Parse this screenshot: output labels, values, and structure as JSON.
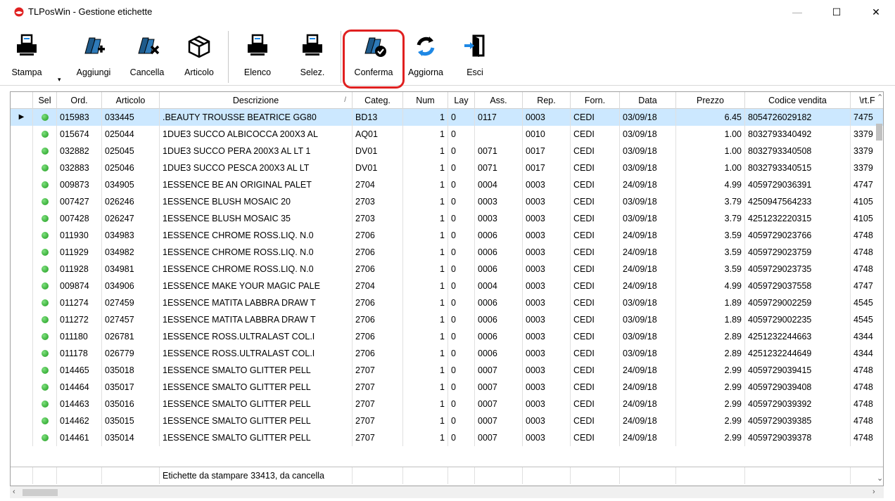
{
  "window": {
    "title": "TLPosWin - Gestione etichette",
    "minimize": "—",
    "maximize": "☐",
    "close": "✕"
  },
  "toolbar": {
    "stampa": "Stampa",
    "aggiungi": "Aggiungi",
    "cancella": "Cancella",
    "articolo": "Articolo",
    "elenco": "Elenco",
    "selez": "Selez.",
    "conferma": "Conferma",
    "aggiorna": "Aggiorna",
    "esci": "Esci"
  },
  "columns": [
    "Sel",
    "Ord.",
    "Articolo",
    "Descrizione",
    "Categ.",
    "Num",
    "Lay",
    "Ass.",
    "Rep.",
    "Forn.",
    "Data",
    "Prezzo",
    "Codice vendita",
    "\\rt.F"
  ],
  "sort_indicator": "/",
  "rows": [
    [
      "015983",
      "033445",
      ".BEAUTY TROUSSE BEATRICE GG80",
      "BD13",
      "1",
      "0",
      "0117",
      "0003",
      "CEDI",
      "03/09/18",
      "6.45",
      "8054726029182",
      "7475"
    ],
    [
      "015674",
      "025044",
      "1DUE3 SUCCO ALBICOCCA 200X3 AL",
      "AQ01",
      "1",
      "0",
      "",
      "0010",
      "CEDI",
      "03/09/18",
      "1.00",
      "8032793340492",
      "3379"
    ],
    [
      "032882",
      "025045",
      "1DUE3 SUCCO PERA 200X3 AL LT 1",
      "DV01",
      "1",
      "0",
      "0071",
      "0017",
      "CEDI",
      "03/09/18",
      "1.00",
      "8032793340508",
      "3379"
    ],
    [
      "032883",
      "025046",
      "1DUE3 SUCCO PESCA 200X3 AL LT",
      "DV01",
      "1",
      "0",
      "0071",
      "0017",
      "CEDI",
      "03/09/18",
      "1.00",
      "8032793340515",
      "3379"
    ],
    [
      "009873",
      "034905",
      "1ESSENCE BE AN ORIGINAL PALET",
      "2704",
      "1",
      "0",
      "0004",
      "0003",
      "CEDI",
      "24/09/18",
      "4.99",
      "4059729036391",
      "4747"
    ],
    [
      "007427",
      "026246",
      "1ESSENCE BLUSH MOSAIC 20",
      "2703",
      "1",
      "0",
      "0003",
      "0003",
      "CEDI",
      "03/09/18",
      "3.79",
      "4250947564233",
      "4105"
    ],
    [
      "007428",
      "026247",
      "1ESSENCE BLUSH MOSAIC 35",
      "2703",
      "1",
      "0",
      "0003",
      "0003",
      "CEDI",
      "03/09/18",
      "3.79",
      "4251232220315",
      "4105"
    ],
    [
      "011930",
      "034983",
      "1ESSENCE CHROME ROSS.LIQ. N.0",
      "2706",
      "1",
      "0",
      "0006",
      "0003",
      "CEDI",
      "24/09/18",
      "3.59",
      "4059729023766",
      "4748"
    ],
    [
      "011929",
      "034982",
      "1ESSENCE CHROME ROSS.LIQ. N.0",
      "2706",
      "1",
      "0",
      "0006",
      "0003",
      "CEDI",
      "24/09/18",
      "3.59",
      "4059729023759",
      "4748"
    ],
    [
      "011928",
      "034981",
      "1ESSENCE CHROME ROSS.LIQ. N.0",
      "2706",
      "1",
      "0",
      "0006",
      "0003",
      "CEDI",
      "24/09/18",
      "3.59",
      "4059729023735",
      "4748"
    ],
    [
      "009874",
      "034906",
      "1ESSENCE MAKE YOUR MAGIC PALE",
      "2704",
      "1",
      "0",
      "0004",
      "0003",
      "CEDI",
      "24/09/18",
      "4.99",
      "4059729037558",
      "4747"
    ],
    [
      "011274",
      "027459",
      "1ESSENCE MATITA LABBRA DRAW T",
      "2706",
      "1",
      "0",
      "0006",
      "0003",
      "CEDI",
      "03/09/18",
      "1.89",
      "4059729002259",
      "4545"
    ],
    [
      "011272",
      "027457",
      "1ESSENCE MATITA LABBRA DRAW T",
      "2706",
      "1",
      "0",
      "0006",
      "0003",
      "CEDI",
      "03/09/18",
      "1.89",
      "4059729002235",
      "4545"
    ],
    [
      "011180",
      "026781",
      "1ESSENCE ROSS.ULTRALAST COL.I",
      "2706",
      "1",
      "0",
      "0006",
      "0003",
      "CEDI",
      "03/09/18",
      "2.89",
      "4251232244663",
      "4344"
    ],
    [
      "011178",
      "026779",
      "1ESSENCE ROSS.ULTRALAST COL.I",
      "2706",
      "1",
      "0",
      "0006",
      "0003",
      "CEDI",
      "03/09/18",
      "2.89",
      "4251232244649",
      "4344"
    ],
    [
      "014465",
      "035018",
      "1ESSENCE SMALTO GLITTER PELL",
      "2707",
      "1",
      "0",
      "0007",
      "0003",
      "CEDI",
      "24/09/18",
      "2.99",
      "4059729039415",
      "4748"
    ],
    [
      "014464",
      "035017",
      "1ESSENCE SMALTO GLITTER PELL",
      "2707",
      "1",
      "0",
      "0007",
      "0003",
      "CEDI",
      "24/09/18",
      "2.99",
      "4059729039408",
      "4748"
    ],
    [
      "014463",
      "035016",
      "1ESSENCE SMALTO GLITTER PELL",
      "2707",
      "1",
      "0",
      "0007",
      "0003",
      "CEDI",
      "24/09/18",
      "2.99",
      "4059729039392",
      "4748"
    ],
    [
      "014462",
      "035015",
      "1ESSENCE SMALTO GLITTER PELL",
      "2707",
      "1",
      "0",
      "0007",
      "0003",
      "CEDI",
      "24/09/18",
      "2.99",
      "4059729039385",
      "4748"
    ],
    [
      "014461",
      "035014",
      "1ESSENCE SMALTO GLITTER PELL",
      "2707",
      "1",
      "0",
      "0007",
      "0003",
      "CEDI",
      "24/09/18",
      "2.99",
      "4059729039378",
      "4748"
    ]
  ],
  "footer": {
    "status": "Etichette da stampare 33413, da cancella"
  },
  "colors": {
    "selected_row": "#cce8ff",
    "highlight": "#e02020",
    "status_dot": "#1a9a1a"
  }
}
